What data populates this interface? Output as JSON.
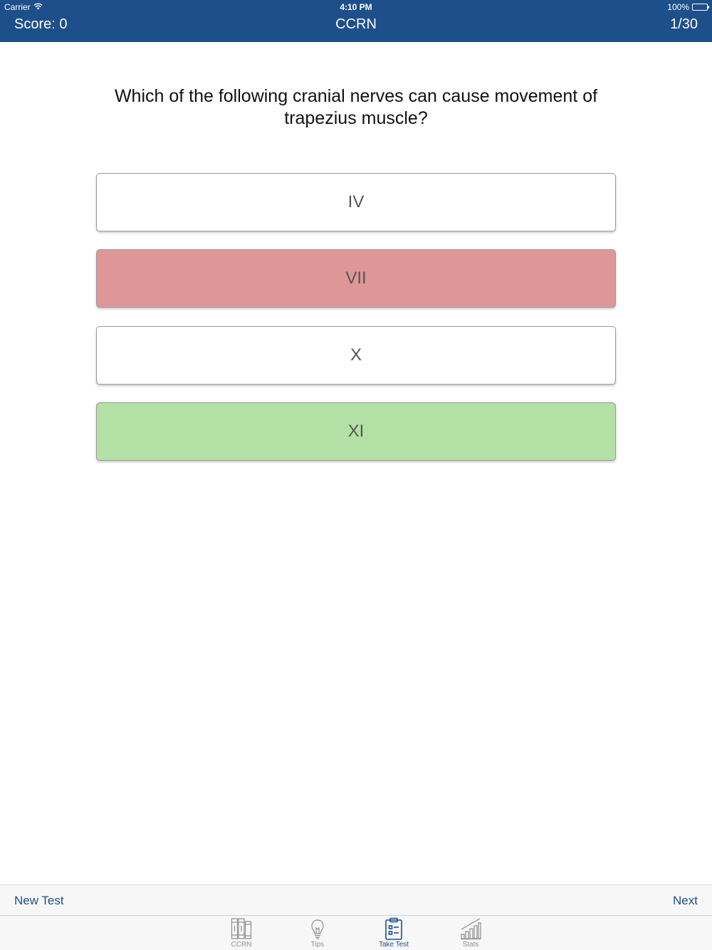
{
  "status_bar": {
    "carrier": "Carrier",
    "time": "4:10 PM",
    "battery_percent": "100%",
    "battery_level": 1.0
  },
  "nav": {
    "score": "Score: 0",
    "title": "CCRN",
    "progress": "1/30"
  },
  "question": {
    "text": "Which of the following cranial nerves can cause movement of trapezius muscle?"
  },
  "answers": [
    {
      "label": "IV",
      "state": "neutral"
    },
    {
      "label": "VII",
      "state": "wrong"
    },
    {
      "label": "X",
      "state": "neutral"
    },
    {
      "label": "XI",
      "state": "correct"
    }
  ],
  "toolbar": {
    "new_test": "New Test",
    "next": "Next"
  },
  "tabs": [
    {
      "label": "CCRN",
      "icon": "books-icon",
      "active": false
    },
    {
      "label": "Tips",
      "icon": "lightbulb-icon",
      "active": false
    },
    {
      "label": "Take Test",
      "icon": "clipboard-icon",
      "active": true
    },
    {
      "label": "Stats",
      "icon": "bar-chart-icon",
      "active": false
    }
  ],
  "colors": {
    "primary": "#1d4f8a",
    "wrong_answer": "#de9797",
    "correct_answer": "#b2e0a5",
    "inactive_tab": "#8e8e8e"
  }
}
